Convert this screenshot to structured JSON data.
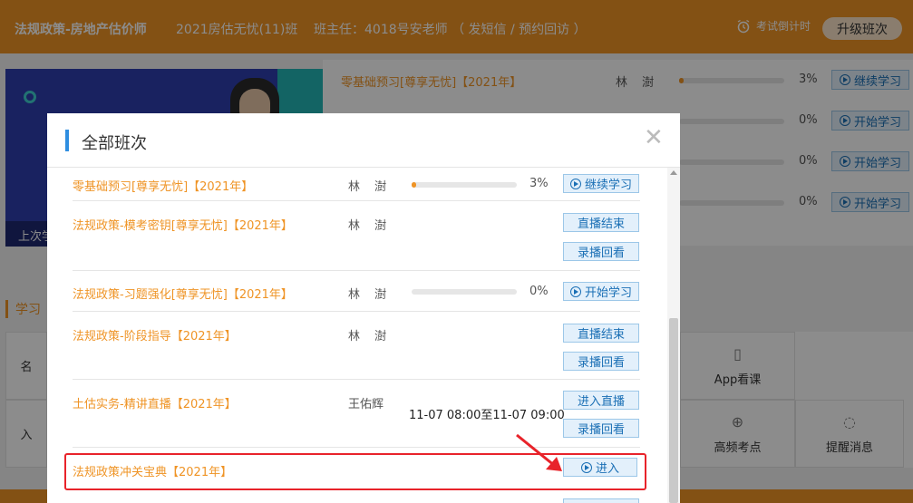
{
  "header": {
    "course_title": "法规政策-房地产估价师",
    "class_name": "2021房估无忧(11)班",
    "head_teacher": "班主任：4018号安老师 （ 发短信 / 预约回访 ）",
    "timer_label": "考试倒计时",
    "upgrade_label": "升级班次"
  },
  "banner": {
    "last_study_label": "上次学"
  },
  "background_list": [
    {
      "title": "零基础预习[尊享无忧]【2021年】",
      "teacher": "林 澍",
      "progress": 0.03,
      "percent": "3%",
      "button": "继续学习"
    },
    {
      "title": "",
      "teacher": "",
      "progress": 0,
      "percent": "0%",
      "button": "开始学习"
    },
    {
      "title": "",
      "teacher": "",
      "progress": 0,
      "percent": "0%",
      "button": "开始学习"
    },
    {
      "title": "",
      "teacher": "",
      "progress": 0,
      "percent": "0%",
      "button": "开始学习"
    }
  ],
  "study_section": {
    "label": "学习",
    "tiles": [
      "App看课",
      "高频考点",
      "提醒消息"
    ],
    "left_stub_1": "名",
    "left_stub_2": "入"
  },
  "modal": {
    "title": "全部班次",
    "rows": [
      {
        "title": "零基础预习[尊享无忧]【2021年】",
        "teacher": "林 澍",
        "progress": 0.03,
        "percent": "3%",
        "buttons": [
          "继续学习"
        ],
        "time": ""
      },
      {
        "title": "法规政策-模考密钥[尊享无忧]【2021年】",
        "teacher": "林 澍",
        "progress": null,
        "percent": "",
        "buttons": [
          "直播结束",
          "录播回看"
        ],
        "time": ""
      },
      {
        "title": "法规政策-习题强化[尊享无忧]【2021年】",
        "teacher": "林 澍",
        "progress": 0,
        "percent": "0%",
        "buttons": [
          "开始学习"
        ],
        "time": ""
      },
      {
        "title": "法规政策-阶段指导【2021年】",
        "teacher": "林 澍",
        "progress": null,
        "percent": "",
        "buttons": [
          "直播结束",
          "录播回看"
        ],
        "time": ""
      },
      {
        "title": "土估实务-精讲直播【2021年】",
        "teacher": "王佑辉",
        "progress": null,
        "percent": "",
        "buttons": [
          "进入直播",
          "录播回看"
        ],
        "time": "11-07 08:00至11-07 09:00"
      },
      {
        "title": "法规政策冲关宝典【2021年】",
        "teacher": "",
        "progress": null,
        "percent": "",
        "buttons": [
          "进入"
        ],
        "time": ""
      }
    ]
  },
  "colors": {
    "brand_orange": "#ef9426",
    "link_blue": "#1a6fb5",
    "highlight_red": "#e8232a"
  }
}
